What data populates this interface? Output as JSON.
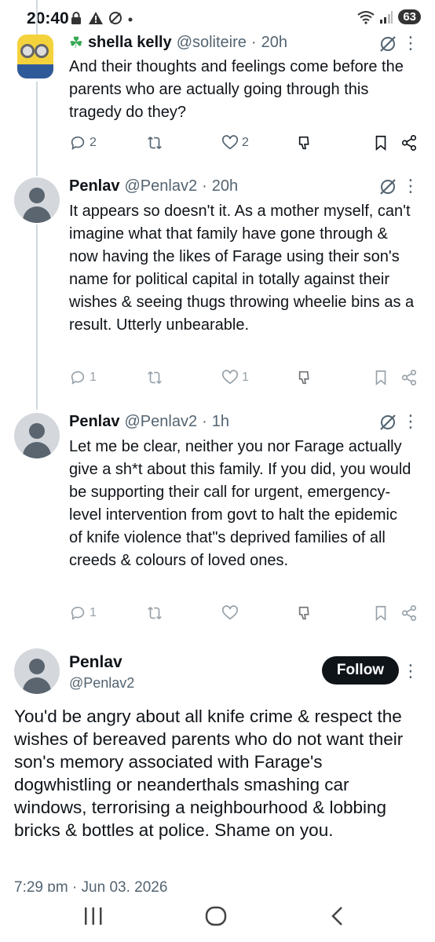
{
  "status_bar": {
    "time": "20:40",
    "battery": "63",
    "icons": [
      "lock-icon",
      "warning-icon",
      "no-sync-icon",
      "dot-icon",
      "wifi-icon",
      "signal-icon",
      "battery-icon"
    ]
  },
  "tweets": [
    {
      "name": "shella kelly",
      "handle": "@soliteire",
      "dot": "·",
      "time": "20h",
      "text": "And their thoughts and feelings come before the parents who are actually going through this tragedy do they?",
      "replies": "2",
      "reposts": "",
      "likes": "2"
    },
    {
      "name": "Penlav",
      "handle": "@Penlav2",
      "dot": "·",
      "time": "20h",
      "text": "It appears so doesn't it. As a mother myself, can't imagine what that family have gone through & now having the likes of Farage using their son's name for political capital in totally against their wishes & seeing thugs throwing wheelie bins as a result. Utterly unbearable.",
      "replies": "1",
      "reposts": "",
      "likes": "1"
    },
    {
      "name": "Penlav",
      "handle": "@Penlav2",
      "dot": "·",
      "time": "1h",
      "text": "Let me be clear, neither you nor Farage actually give a sh*t about this family. If you did, you would be supporting their call for urgent, emergency-level intervention from govt to halt the epidemic of knife violence that\"s deprived families of all creeds & colours of loved ones.",
      "replies": "1",
      "reposts": "",
      "likes": ""
    }
  ],
  "main_tweet": {
    "name": "Penlav",
    "handle": "@Penlav2",
    "follow_label": "Follow",
    "text": "You'd be angry about all knife crime & respect the wishes of bereaved parents who do not want their son's memory associated with Farage's dogwhistling or neanderthals smashing car windows, terrorising a neighbourhood & lobbing bricks & bottles at police. Shame on you.",
    "timestamp": "7:29 pm · Jun 03, 2026"
  },
  "more_glyph": "⋮",
  "colors": {
    "text": "#0f1419",
    "muted": "#536471",
    "follow_bg": "#0f1419",
    "line": "#cfd9de"
  }
}
